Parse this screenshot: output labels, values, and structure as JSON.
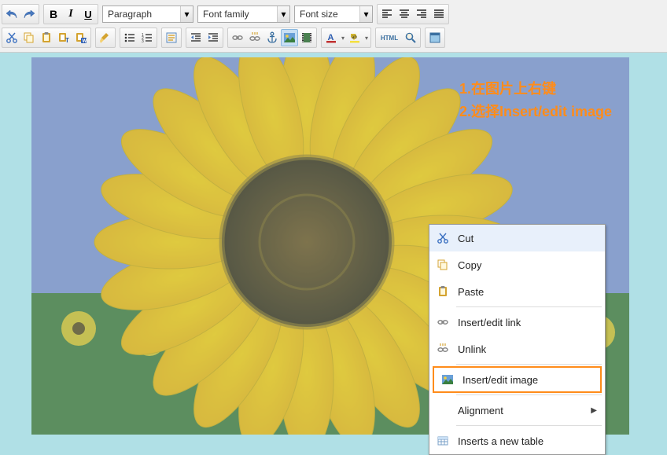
{
  "toolbar": {
    "dropdowns": {
      "paragraph": "Paragraph",
      "fontFamily": "Font family",
      "fontSize": "Font size"
    }
  },
  "annotation": {
    "line1": "1.在图片上右键",
    "line2": "2.选择Insert/edit image"
  },
  "contextMenu": {
    "cut": "Cut",
    "copy": "Copy",
    "paste": "Paste",
    "insertLink": "Insert/edit link",
    "unlink": "Unlink",
    "insertImage": "Insert/edit image",
    "alignment": "Alignment",
    "insertTable": "Inserts a new table"
  }
}
